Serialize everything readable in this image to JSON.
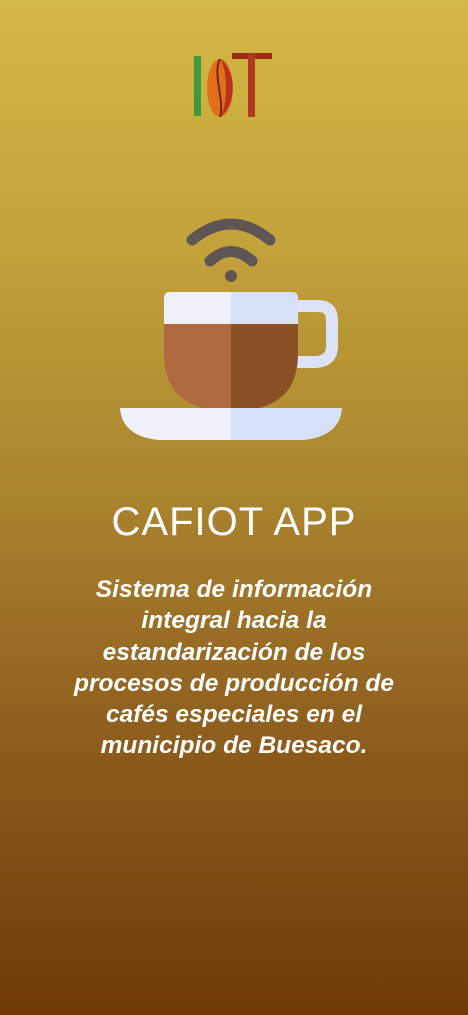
{
  "logo": {
    "letters": "IoT",
    "colors": {
      "green": "#3f9b3a",
      "bean_orange": "#e0701a",
      "bean_red": "#b8331d",
      "t_red": "#9c2a17"
    }
  },
  "hero": {
    "icon": "coffee-cup-wifi-icon",
    "colors": {
      "wifi": "#5f5552",
      "foam_light": "#eef1fb",
      "foam_dark": "#d7e2f7",
      "coffee_light": "#b06a3f",
      "coffee_dark": "#8a4f22",
      "handle": "#dde3f6",
      "saucer_light": "#eef1fb",
      "saucer_dark": "#d4e1f6"
    }
  },
  "app_title": "CAFIOT APP",
  "subtitle": "Sistema de información integral hacia la estandarización de los procesos de producción de cafés especiales en el municipio de Buesaco."
}
